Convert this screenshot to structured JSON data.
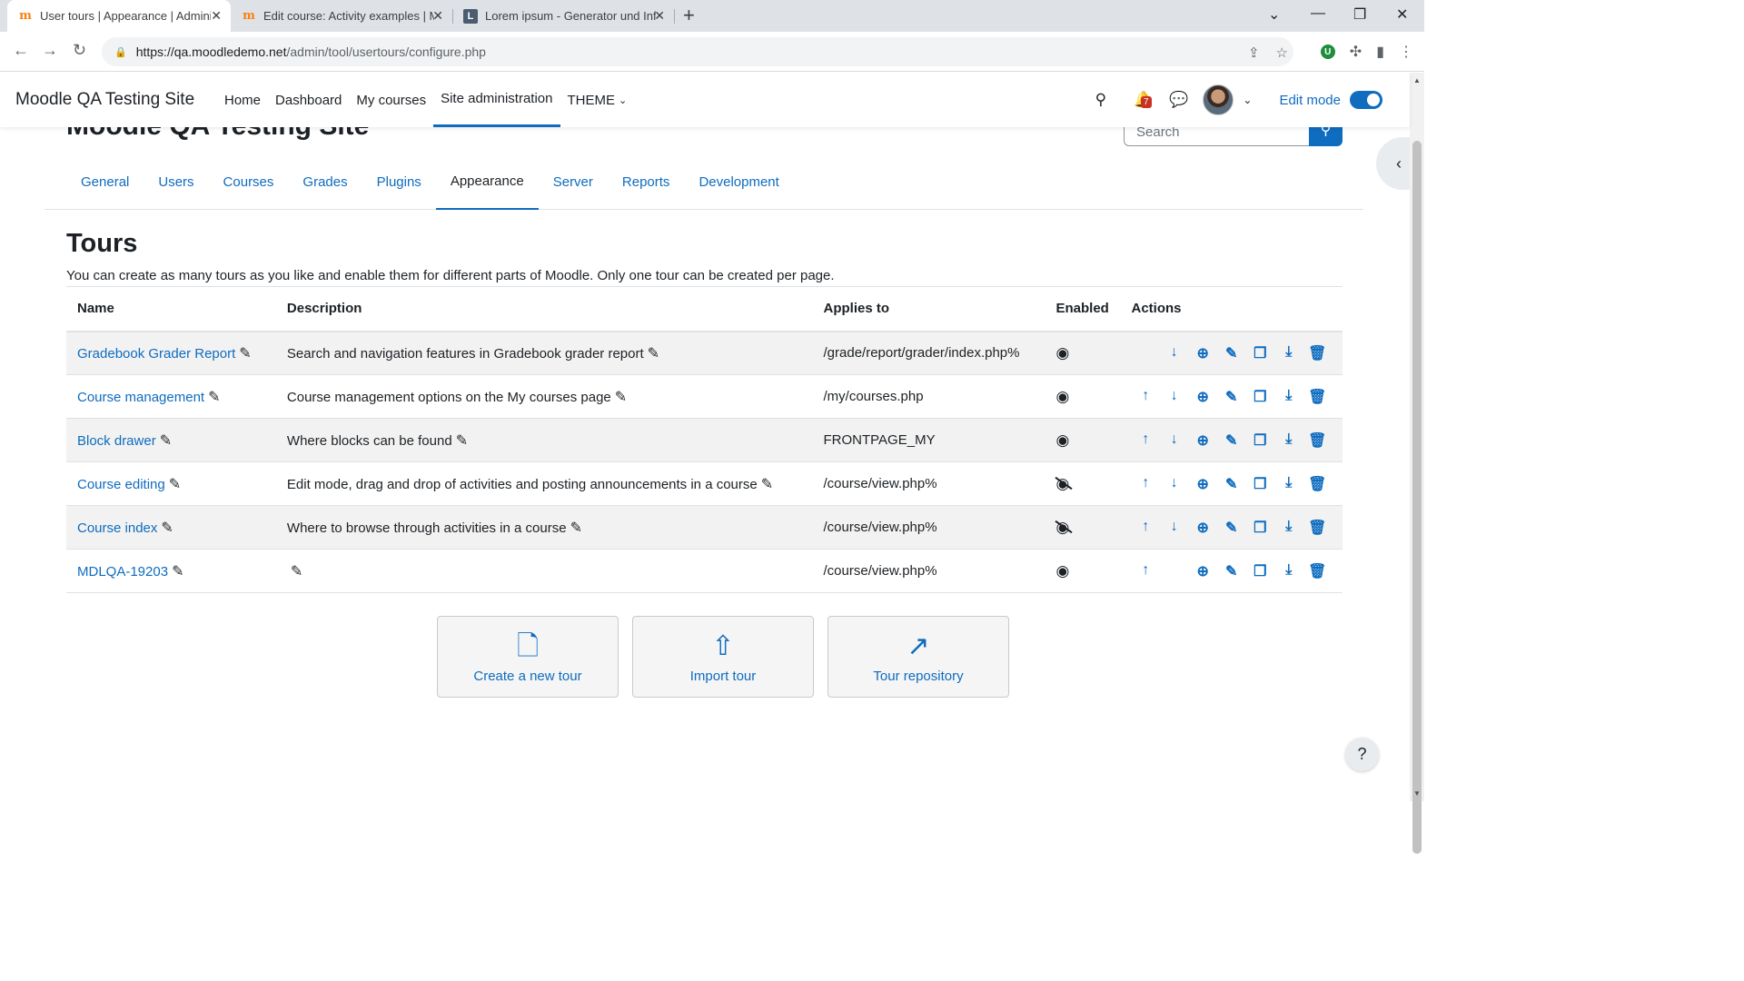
{
  "browser": {
    "tabs": [
      {
        "title": "User tours | Appearance | Admini",
        "favicon": "moodle-favicon",
        "active": true
      },
      {
        "title": "Edit course: Activity examples | M",
        "favicon": "moodle-favicon",
        "active": false
      },
      {
        "title": "Lorem ipsum - Generator und Inf",
        "favicon": "lorem-favicon",
        "active": false
      }
    ],
    "url_host": "https://qa.moodledemo.net",
    "url_path": "/admin/tool/usertours/configure.php"
  },
  "navbar": {
    "brand": "Moodle QA Testing Site",
    "items": [
      "Home",
      "Dashboard",
      "My courses",
      "Site administration",
      "THEME"
    ],
    "notification_count": "7",
    "edit_mode_label": "Edit mode"
  },
  "page": {
    "heading": "Moodle QA Testing Site",
    "search_placeholder": "Search"
  },
  "secondary_nav": [
    "General",
    "Users",
    "Courses",
    "Grades",
    "Plugins",
    "Appearance",
    "Server",
    "Reports",
    "Development"
  ],
  "tours": {
    "title": "Tours",
    "description": "You can create as many tours as you like and enable them for different parts of Moodle. Only one tour can be created per page.",
    "columns": [
      "Name",
      "Description",
      "Applies to",
      "Enabled",
      "Actions"
    ],
    "rows": [
      {
        "name": "Gradebook Grader Report",
        "description": "Search and navigation features in Gradebook grader report",
        "applies_to": "/grade/report/grader/index.php%",
        "enabled": true
      },
      {
        "name": "Course management",
        "description": "Course management options on the My courses page",
        "applies_to": "/my/courses.php",
        "enabled": true
      },
      {
        "name": "Block drawer",
        "description": "Where blocks can be found",
        "applies_to": "FRONTPAGE_MY",
        "enabled": true
      },
      {
        "name": "Course editing",
        "description": "Edit mode, drag and drop of activities and posting announcements in a course",
        "applies_to": "/course/view.php%",
        "enabled": false
      },
      {
        "name": "Course index",
        "description": "Where to browse through activities in a course",
        "applies_to": "/course/view.php%",
        "enabled": false
      },
      {
        "name": "MDLQA-19203",
        "description": "",
        "applies_to": "/course/view.php%",
        "enabled": true
      }
    ]
  },
  "buttons": {
    "create": "Create a new tour",
    "import": "Import tour",
    "repository": "Tour repository"
  },
  "help_label": "?",
  "colors": {
    "accent": "#0f6cbf",
    "stripe": "#f2f2f2"
  }
}
